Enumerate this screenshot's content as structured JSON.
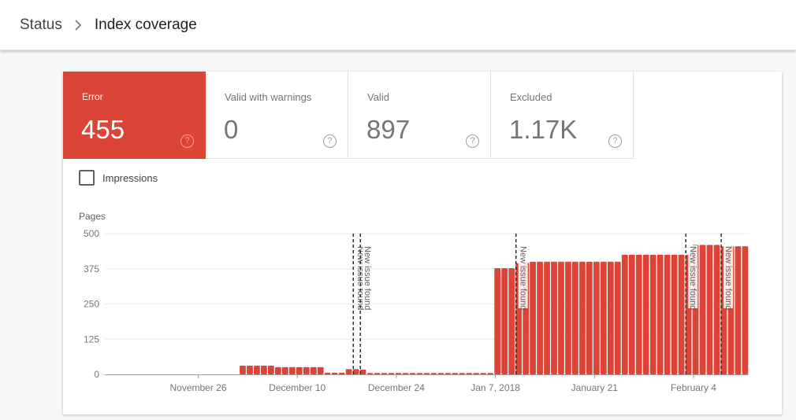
{
  "breadcrumb": {
    "parent": "Status",
    "separator_icon": "chevron-right-icon",
    "current": "Index coverage"
  },
  "tiles": [
    {
      "label": "Error",
      "value": "455",
      "active": true,
      "color": "#db4437",
      "help_icon": "help-circle-icon"
    },
    {
      "label": "Valid with warnings",
      "value": "0",
      "active": false,
      "help_icon": "help-circle-icon"
    },
    {
      "label": "Valid",
      "value": "897",
      "active": false,
      "help_icon": "help-circle-icon"
    },
    {
      "label": "Excluded",
      "value": "1.17K",
      "active": false,
      "help_icon": "help-circle-icon"
    }
  ],
  "impressions": {
    "label": "Impressions",
    "checked": false
  },
  "chart_data": {
    "type": "bar",
    "title": "",
    "ylabel": "Pages",
    "xlabel": "",
    "ylim": [
      0,
      500
    ],
    "yticks": [
      0,
      125,
      250,
      375,
      500
    ],
    "grid": true,
    "bar_color": "#db4437",
    "x_start": "2017-11-13",
    "x_end": "2018-02-11",
    "xticks": [
      {
        "date": "2017-11-26",
        "label": "November 26"
      },
      {
        "date": "2017-12-10",
        "label": "December 10"
      },
      {
        "date": "2017-12-24",
        "label": "December 24"
      },
      {
        "date": "2018-01-07",
        "label": "Jan 7, 2018"
      },
      {
        "date": "2018-01-21",
        "label": "January 21"
      },
      {
        "date": "2018-02-04",
        "label": "February 4"
      }
    ],
    "series": [
      {
        "name": "Error",
        "start_date": "2017-12-02",
        "values": [
          31,
          31,
          31,
          31,
          31,
          26,
          26,
          26,
          26,
          26,
          26,
          26,
          6,
          6,
          6,
          19,
          19,
          17,
          5,
          5,
          5,
          5,
          5,
          5,
          5,
          5,
          5,
          5,
          5,
          5,
          5,
          5,
          5,
          5,
          5,
          5,
          377,
          377,
          377,
          395,
          397,
          400,
          400,
          400,
          400,
          400,
          400,
          400,
          400,
          400,
          400,
          400,
          400,
          400,
          425,
          425,
          425,
          425,
          425,
          425,
          425,
          425,
          425,
          425,
          460,
          460,
          460,
          460,
          455,
          455,
          455,
          455
        ]
      }
    ],
    "annotations": [
      {
        "date": "2017-12-18",
        "label": "New issue found"
      },
      {
        "date": "2017-12-19",
        "label": "New issue found"
      },
      {
        "date": "2018-01-10",
        "label": "New issue found"
      },
      {
        "date": "2018-02-03",
        "label": "New issue found"
      },
      {
        "date": "2018-02-08",
        "label": "New issue found"
      }
    ]
  }
}
